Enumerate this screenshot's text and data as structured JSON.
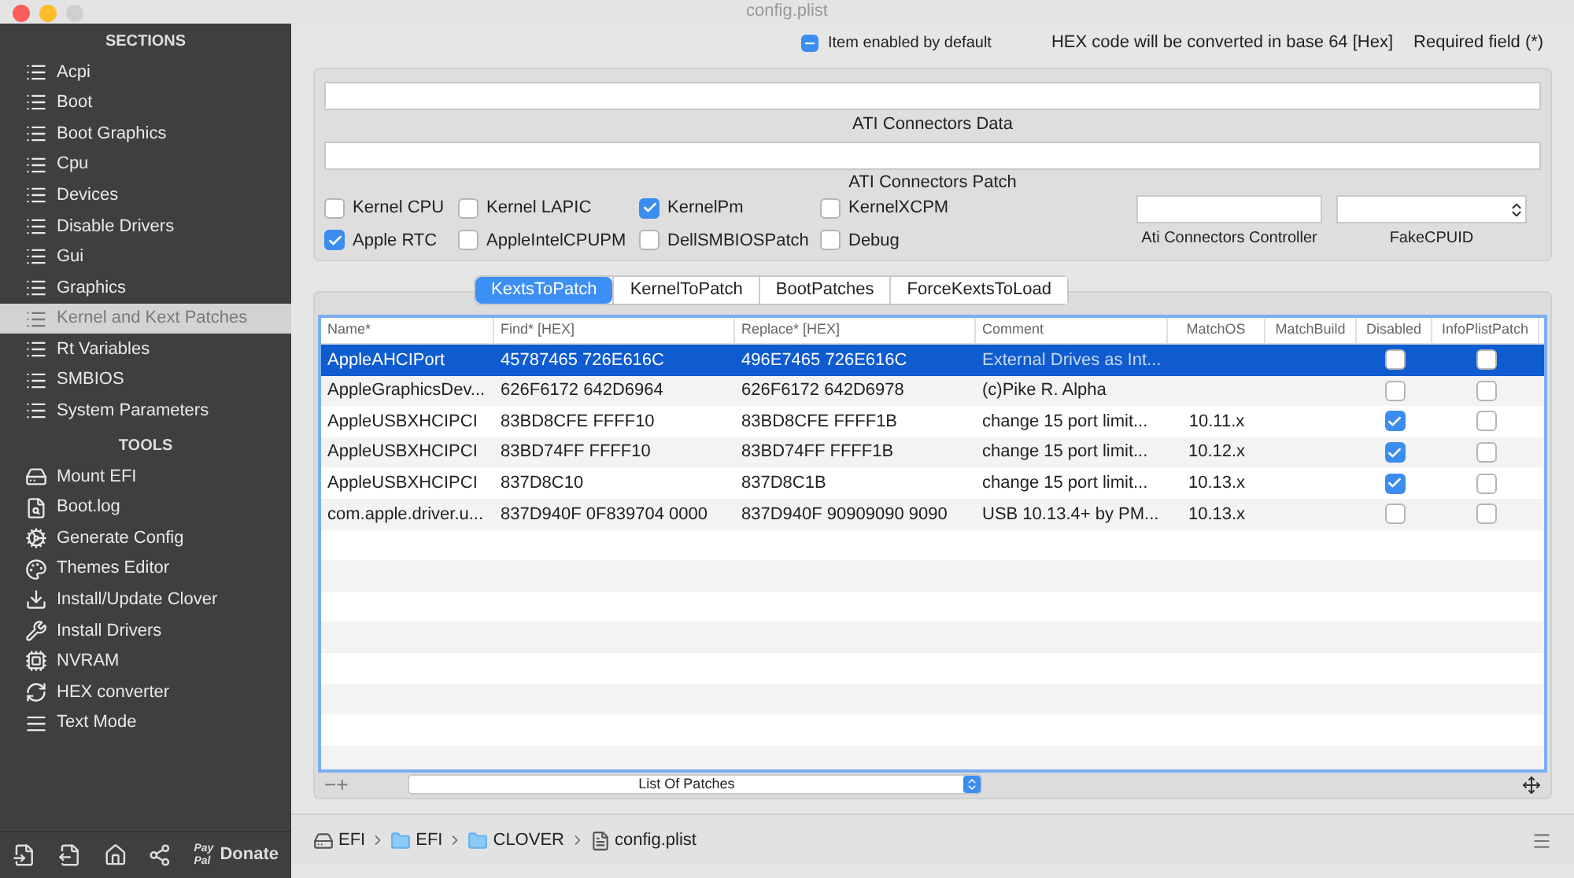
{
  "window": {
    "title": "config.plist"
  },
  "sidebar": {
    "sections_title": "SECTIONS",
    "sections": [
      {
        "label": "Acpi",
        "selected": false
      },
      {
        "label": "Boot",
        "selected": false
      },
      {
        "label": "Boot Graphics",
        "selected": false
      },
      {
        "label": "Cpu",
        "selected": false
      },
      {
        "label": "Devices",
        "selected": false
      },
      {
        "label": "Disable Drivers",
        "selected": false
      },
      {
        "label": "Gui",
        "selected": false
      },
      {
        "label": "Graphics",
        "selected": false
      },
      {
        "label": "Kernel and Kext Patches",
        "selected": true
      },
      {
        "label": "Rt Variables",
        "selected": false
      },
      {
        "label": "SMBIOS",
        "selected": false
      },
      {
        "label": "System Parameters",
        "selected": false
      }
    ],
    "tools_title": "TOOLS",
    "tools": [
      {
        "label": "Mount EFI",
        "kind": "disk"
      },
      {
        "label": "Boot.log",
        "kind": "log"
      },
      {
        "label": "Generate Config",
        "kind": "gears"
      },
      {
        "label": "Themes Editor",
        "kind": "palette"
      },
      {
        "label": "Install/Update Clover",
        "kind": "download"
      },
      {
        "label": "Install Drivers",
        "kind": "tools"
      },
      {
        "label": "NVRAM",
        "kind": "chip"
      },
      {
        "label": "HEX converter",
        "kind": "convert"
      },
      {
        "label": "Text Mode",
        "kind": "text"
      }
    ],
    "footer": {
      "paypal_top": "Pay",
      "paypal_bottom": "Pal",
      "donate": "Donate"
    }
  },
  "header": {
    "enabled_default": {
      "label": "Item enabled by default",
      "indeterminate": true
    },
    "hex_note": "HEX code will be converted in base 64 [Hex]",
    "required_note": "Required field (*)"
  },
  "ati": {
    "data_label": "ATI Connectors Data",
    "patch_label": "ATI Connectors Patch",
    "controller_label": "Ati Connectors Controller",
    "fakecpuid_label": "FakeCPUID"
  },
  "options": [
    [
      {
        "label": "Kernel CPU",
        "checked": false
      },
      {
        "label": "Kernel LAPIC",
        "checked": false
      },
      {
        "label": "KernelPm",
        "checked": true
      },
      {
        "label": "KernelXCPM",
        "checked": false
      }
    ],
    [
      {
        "label": "Apple RTC",
        "checked": true
      },
      {
        "label": "AppleIntelCPUPM",
        "checked": false
      },
      {
        "label": "DellSMBIOSPatch",
        "checked": false
      },
      {
        "label": "Debug",
        "checked": false
      }
    ]
  ],
  "tabs": [
    {
      "label": "KextsToPatch",
      "selected": true
    },
    {
      "label": "KernelToPatch",
      "selected": false
    },
    {
      "label": "BootPatches",
      "selected": false
    },
    {
      "label": "ForceKextsToLoad",
      "selected": false
    }
  ],
  "table": {
    "columns": [
      "Name*",
      "Find* [HEX]",
      "Replace* [HEX]",
      "Comment",
      "MatchOS",
      "MatchBuild",
      "Disabled",
      "InfoPlistPatch"
    ],
    "rows": [
      {
        "name": "AppleAHCIPort",
        "find": "45787465 726E616C",
        "replace": "496E7465 726E616C",
        "comment": "External Drives as Int...",
        "match_os": "",
        "disabled": false,
        "info_plist_patch": false,
        "selected": true
      },
      {
        "name": "AppleGraphicsDev...",
        "find": "626F6172 642D6964",
        "replace": "626F6172 642D6978",
        "comment": "(c)Pike R. Alpha",
        "match_os": "",
        "disabled": false,
        "info_plist_patch": false,
        "selected": false
      },
      {
        "name": "AppleUSBXHCIPCI",
        "find": "83BD8CFE FFFF10",
        "replace": "83BD8CFE FFFF1B",
        "comment": "change 15 port limit...",
        "match_os": "10.11.x",
        "disabled": true,
        "info_plist_patch": false,
        "selected": false
      },
      {
        "name": "AppleUSBXHCIPCI",
        "find": "83BD74FF FFFF10",
        "replace": "83BD74FF FFFF1B",
        "comment": "change 15 port limit...",
        "match_os": "10.12.x",
        "disabled": true,
        "info_plist_patch": false,
        "selected": false
      },
      {
        "name": "AppleUSBXHCIPCI",
        "find": "837D8C10",
        "replace": "837D8C1B",
        "comment": "change 15 port limit...",
        "match_os": "10.13.x",
        "disabled": true,
        "info_plist_patch": false,
        "selected": false
      },
      {
        "name": "com.apple.driver.u...",
        "find": "837D940F 0F839704 0000",
        "replace": "837D940F 90909090 9090",
        "comment": "USB 10.13.4+ by PM...",
        "match_os": "10.13.x",
        "disabled": false,
        "info_plist_patch": false,
        "selected": false
      }
    ]
  },
  "table_footer": {
    "minus": "−",
    "plus": "+",
    "list_select": "List Of Patches"
  },
  "path_bar": [
    {
      "label": "EFI",
      "kind": "disk"
    },
    {
      "label": "EFI",
      "kind": "folder"
    },
    {
      "label": "CLOVER",
      "kind": "folder"
    },
    {
      "label": "config.plist",
      "kind": "file"
    }
  ]
}
